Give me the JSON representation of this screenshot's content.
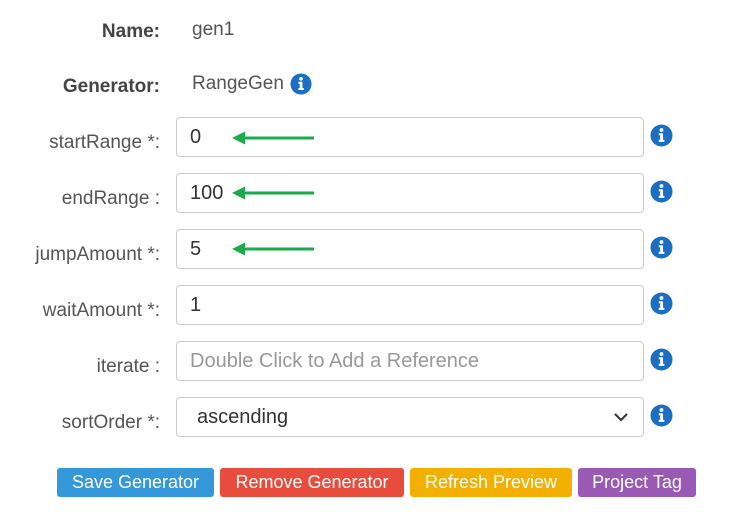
{
  "name": {
    "label": "Name:",
    "value": "gen1"
  },
  "generator": {
    "label": "Generator:",
    "value": "RangeGen",
    "icon": "info-icon"
  },
  "fields": {
    "startRange": {
      "label": "startRange *:",
      "value": "0"
    },
    "endRange": {
      "label": "endRange :",
      "value": "100"
    },
    "jumpAmount": {
      "label": "jumpAmount *:",
      "value": "5"
    },
    "waitAmount": {
      "label": "waitAmount *:",
      "value": "1"
    },
    "iterate": {
      "label": "iterate :",
      "value": "",
      "placeholder": "Double Click to Add a Reference"
    },
    "sortOrder": {
      "label": "sortOrder *:",
      "value": "ascending",
      "icon": "chevron-down-icon"
    }
  },
  "buttons": {
    "save": {
      "label": "Save Generator",
      "color": "#3498db"
    },
    "remove": {
      "label": "Remove Generator",
      "color": "#e74c3c"
    },
    "refresh": {
      "label": "Refresh Preview",
      "color": "#f3b000"
    },
    "tag": {
      "label": "Project Tag",
      "color": "#9b59b6"
    }
  },
  "colors": {
    "info_icon": "#1a6fc4",
    "annotation_arrow": "#1aab4c"
  }
}
